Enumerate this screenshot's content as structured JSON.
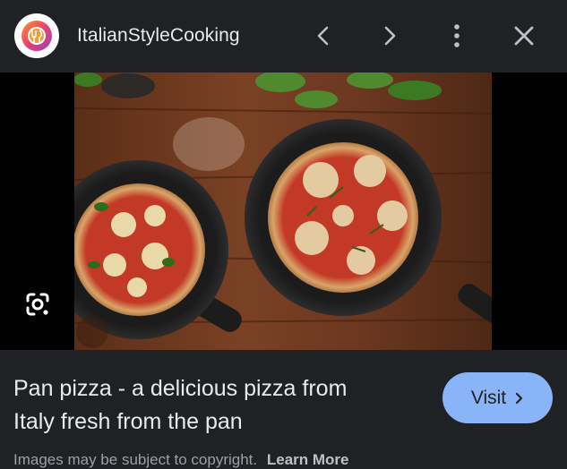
{
  "header": {
    "site_name": "ItalianStyleCooking",
    "logo_icon": "italian-style-cooking-logo",
    "prev_icon": "chevron-left-icon",
    "next_icon": "chevron-right-icon",
    "more_icon": "more-vert-icon",
    "close_icon": "close-icon"
  },
  "image": {
    "description_icon": "google-lens-icon",
    "alt": "Pan pizza - a delicious pizza from Italy fresh from the pan"
  },
  "caption": {
    "line1": "Pan pizza - a delicious pizza from",
    "line2": "Italy fresh from the pan"
  },
  "visit_button": {
    "label": "Visit",
    "color": "#8ab4f8"
  },
  "footer": {
    "copyright_text": "Images may be subject to copyright.",
    "learn_more": "Learn More"
  }
}
